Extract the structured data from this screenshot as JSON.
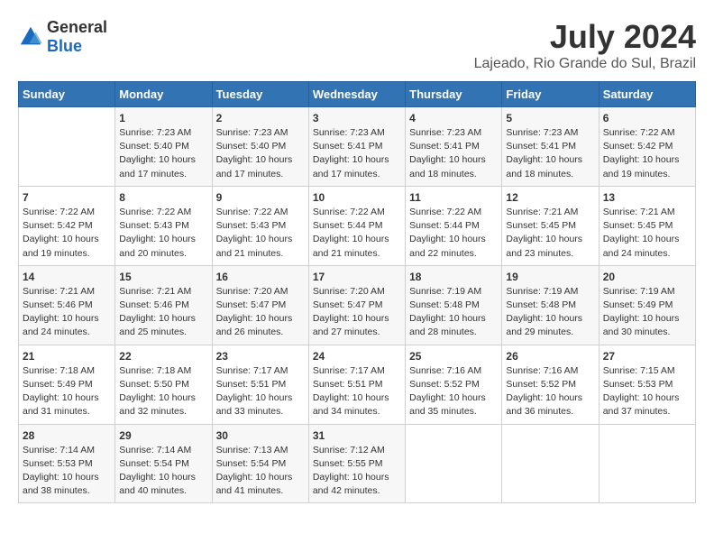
{
  "header": {
    "logo_general": "General",
    "logo_blue": "Blue",
    "month": "July 2024",
    "location": "Lajeado, Rio Grande do Sul, Brazil"
  },
  "days_of_week": [
    "Sunday",
    "Monday",
    "Tuesday",
    "Wednesday",
    "Thursday",
    "Friday",
    "Saturday"
  ],
  "weeks": [
    [
      {
        "day": "",
        "content": ""
      },
      {
        "day": "1",
        "content": "Sunrise: 7:23 AM\nSunset: 5:40 PM\nDaylight: 10 hours\nand 17 minutes."
      },
      {
        "day": "2",
        "content": "Sunrise: 7:23 AM\nSunset: 5:40 PM\nDaylight: 10 hours\nand 17 minutes."
      },
      {
        "day": "3",
        "content": "Sunrise: 7:23 AM\nSunset: 5:41 PM\nDaylight: 10 hours\nand 17 minutes."
      },
      {
        "day": "4",
        "content": "Sunrise: 7:23 AM\nSunset: 5:41 PM\nDaylight: 10 hours\nand 18 minutes."
      },
      {
        "day": "5",
        "content": "Sunrise: 7:23 AM\nSunset: 5:41 PM\nDaylight: 10 hours\nand 18 minutes."
      },
      {
        "day": "6",
        "content": "Sunrise: 7:22 AM\nSunset: 5:42 PM\nDaylight: 10 hours\nand 19 minutes."
      }
    ],
    [
      {
        "day": "7",
        "content": "Sunrise: 7:22 AM\nSunset: 5:42 PM\nDaylight: 10 hours\nand 19 minutes."
      },
      {
        "day": "8",
        "content": "Sunrise: 7:22 AM\nSunset: 5:43 PM\nDaylight: 10 hours\nand 20 minutes."
      },
      {
        "day": "9",
        "content": "Sunrise: 7:22 AM\nSunset: 5:43 PM\nDaylight: 10 hours\nand 21 minutes."
      },
      {
        "day": "10",
        "content": "Sunrise: 7:22 AM\nSunset: 5:44 PM\nDaylight: 10 hours\nand 21 minutes."
      },
      {
        "day": "11",
        "content": "Sunrise: 7:22 AM\nSunset: 5:44 PM\nDaylight: 10 hours\nand 22 minutes."
      },
      {
        "day": "12",
        "content": "Sunrise: 7:21 AM\nSunset: 5:45 PM\nDaylight: 10 hours\nand 23 minutes."
      },
      {
        "day": "13",
        "content": "Sunrise: 7:21 AM\nSunset: 5:45 PM\nDaylight: 10 hours\nand 24 minutes."
      }
    ],
    [
      {
        "day": "14",
        "content": "Sunrise: 7:21 AM\nSunset: 5:46 PM\nDaylight: 10 hours\nand 24 minutes."
      },
      {
        "day": "15",
        "content": "Sunrise: 7:21 AM\nSunset: 5:46 PM\nDaylight: 10 hours\nand 25 minutes."
      },
      {
        "day": "16",
        "content": "Sunrise: 7:20 AM\nSunset: 5:47 PM\nDaylight: 10 hours\nand 26 minutes."
      },
      {
        "day": "17",
        "content": "Sunrise: 7:20 AM\nSunset: 5:47 PM\nDaylight: 10 hours\nand 27 minutes."
      },
      {
        "day": "18",
        "content": "Sunrise: 7:19 AM\nSunset: 5:48 PM\nDaylight: 10 hours\nand 28 minutes."
      },
      {
        "day": "19",
        "content": "Sunrise: 7:19 AM\nSunset: 5:48 PM\nDaylight: 10 hours\nand 29 minutes."
      },
      {
        "day": "20",
        "content": "Sunrise: 7:19 AM\nSunset: 5:49 PM\nDaylight: 10 hours\nand 30 minutes."
      }
    ],
    [
      {
        "day": "21",
        "content": "Sunrise: 7:18 AM\nSunset: 5:49 PM\nDaylight: 10 hours\nand 31 minutes."
      },
      {
        "day": "22",
        "content": "Sunrise: 7:18 AM\nSunset: 5:50 PM\nDaylight: 10 hours\nand 32 minutes."
      },
      {
        "day": "23",
        "content": "Sunrise: 7:17 AM\nSunset: 5:51 PM\nDaylight: 10 hours\nand 33 minutes."
      },
      {
        "day": "24",
        "content": "Sunrise: 7:17 AM\nSunset: 5:51 PM\nDaylight: 10 hours\nand 34 minutes."
      },
      {
        "day": "25",
        "content": "Sunrise: 7:16 AM\nSunset: 5:52 PM\nDaylight: 10 hours\nand 35 minutes."
      },
      {
        "day": "26",
        "content": "Sunrise: 7:16 AM\nSunset: 5:52 PM\nDaylight: 10 hours\nand 36 minutes."
      },
      {
        "day": "27",
        "content": "Sunrise: 7:15 AM\nSunset: 5:53 PM\nDaylight: 10 hours\nand 37 minutes."
      }
    ],
    [
      {
        "day": "28",
        "content": "Sunrise: 7:14 AM\nSunset: 5:53 PM\nDaylight: 10 hours\nand 38 minutes."
      },
      {
        "day": "29",
        "content": "Sunrise: 7:14 AM\nSunset: 5:54 PM\nDaylight: 10 hours\nand 40 minutes."
      },
      {
        "day": "30",
        "content": "Sunrise: 7:13 AM\nSunset: 5:54 PM\nDaylight: 10 hours\nand 41 minutes."
      },
      {
        "day": "31",
        "content": "Sunrise: 7:12 AM\nSunset: 5:55 PM\nDaylight: 10 hours\nand 42 minutes."
      },
      {
        "day": "",
        "content": ""
      },
      {
        "day": "",
        "content": ""
      },
      {
        "day": "",
        "content": ""
      }
    ]
  ]
}
